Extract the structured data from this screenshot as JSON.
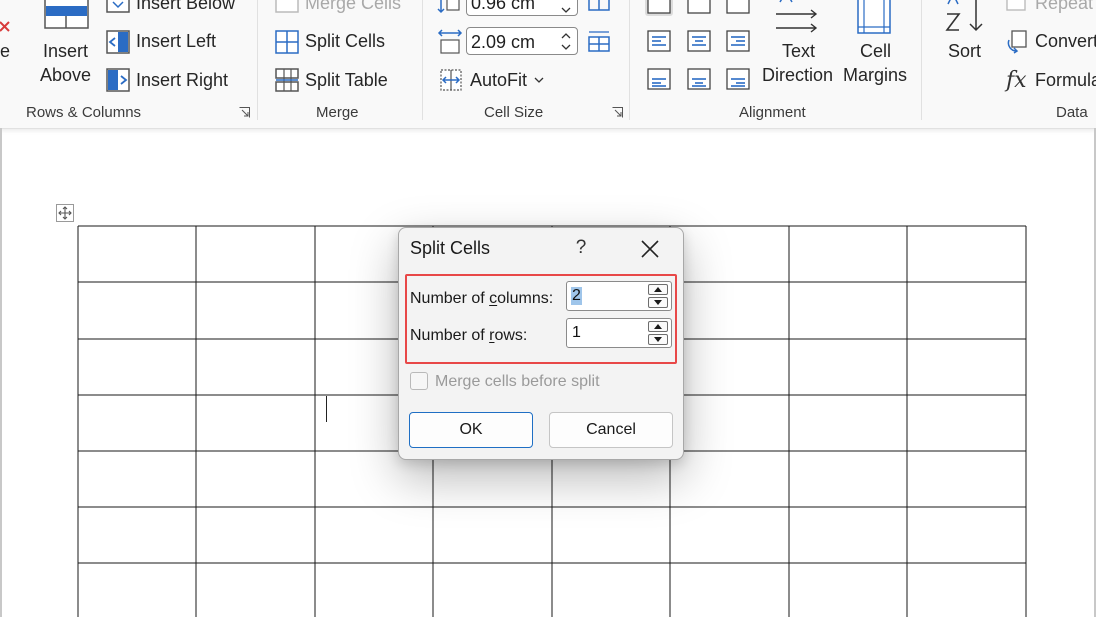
{
  "ribbon": {
    "rows_columns": {
      "label": "Rows & Columns",
      "insert_above": [
        "Insert",
        "Above"
      ],
      "insert_below": "Insert Below",
      "insert_left": "Insert Left",
      "insert_right": "Insert Right",
      "partial_left": "e"
    },
    "merge": {
      "label": "Merge",
      "merge_cells": "Merge Cells",
      "split_cells": "Split Cells",
      "split_table": "Split Table"
    },
    "cell_size": {
      "label": "Cell Size",
      "height_value": "0.96 cm",
      "width_value": "2.09 cm",
      "autofit": "AutoFit"
    },
    "alignment": {
      "label": "Alignment",
      "text_direction": [
        "Text",
        "Direction"
      ],
      "cell_margins": [
        "Cell",
        "Margins"
      ]
    },
    "data": {
      "label": "Data",
      "sort": "Sort",
      "repeat": "Repeat",
      "convert": "Convert",
      "formula": "Formula",
      "formula_glyph": "fx"
    }
  },
  "dialog": {
    "title": "Split Cells",
    "help": "?",
    "columns_label_pre": "Number of ",
    "columns_label_key": "c",
    "columns_label_post": "olumns:",
    "columns_value": "2",
    "rows_label_pre": "Number of ",
    "rows_label_key": "r",
    "rows_label_post": "ows:",
    "rows_value": "1",
    "merge_label": "Merge cells before split",
    "merge_checked": false,
    "ok": "OK",
    "cancel": "Cancel"
  },
  "colors": {
    "accent_blue": "#1f6fc4",
    "highlight_red": "#e84848",
    "icon_blue": "#2b6cc4"
  }
}
